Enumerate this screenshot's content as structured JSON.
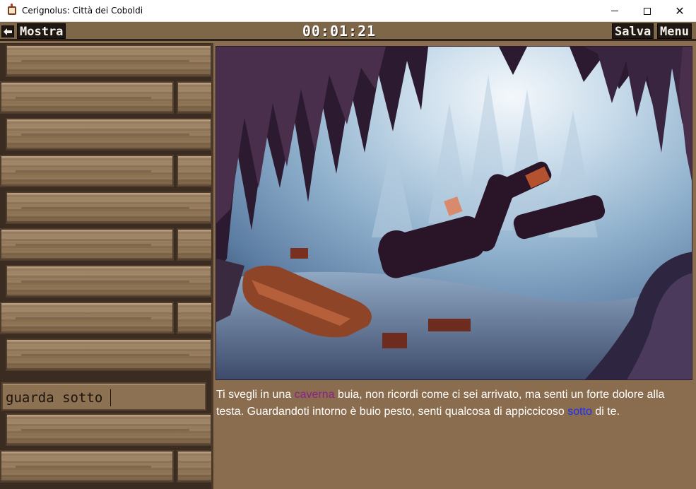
{
  "window": {
    "title": "Cerignolus: Città dei Coboldi",
    "controls": {
      "minimize": "minimize",
      "maximize": "maximize",
      "close": "✕"
    }
  },
  "toolbar": {
    "back_icon": "back-arrow-icon",
    "show_label": "Mostra",
    "timer": "00:01:21",
    "save_label": "Salva",
    "menu_label": "Menu"
  },
  "command": {
    "value": "guarda sotto"
  },
  "scene": {
    "description_icon": "cave-scene-image"
  },
  "narrative": {
    "part1": "Ti svegli in una ",
    "keyword1": "caverna",
    "part2": " buia, non ricordi come ci sei arrivato, ma senti un forte dolore alla testa. Guardandoti intorno è buio pesto, senti qualcosa di appiccicoso ",
    "keyword2": "sotto",
    "part3": " di te."
  },
  "colors": {
    "background": "#8a6d4f",
    "toolbar": "#7e6649",
    "button_bg": "#1f1712",
    "keyword_caverna": "#8b1e8c",
    "keyword_sotto": "#1a2cff"
  }
}
